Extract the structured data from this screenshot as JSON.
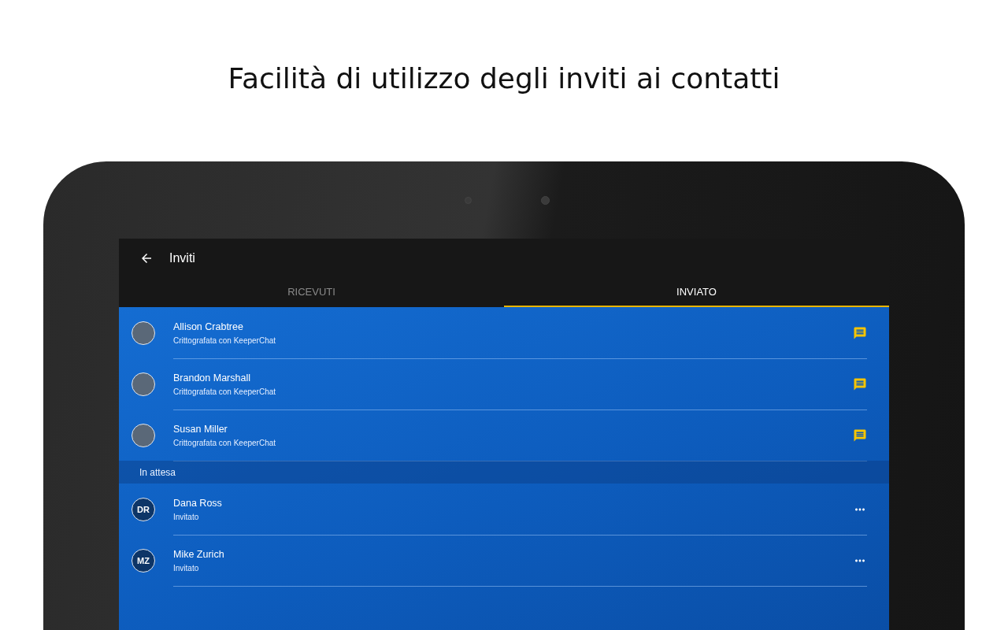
{
  "headline": "Facilità di utilizzo degli inviti ai contatti",
  "app_bar": {
    "title": "Inviti"
  },
  "tabs": [
    {
      "label": "RICEVUTI",
      "selected": false
    },
    {
      "label": "INVIATO",
      "selected": true
    }
  ],
  "groups": [
    {
      "items": [
        {
          "kind": "contact",
          "name": "Allison Crabtree",
          "subtitle": "Crittografata con KeeperChat"
        },
        {
          "kind": "contact",
          "name": "Brandon Marshall",
          "subtitle": "Crittografata con KeeperChat"
        },
        {
          "kind": "contact",
          "name": "Susan Miller",
          "subtitle": "Crittografata con KeeperChat"
        }
      ]
    },
    {
      "header": "In attesa",
      "items": [
        {
          "kind": "pending",
          "initials": "DR",
          "name": "Dana Ross",
          "subtitle": "Invitato"
        },
        {
          "kind": "pending",
          "initials": "MZ",
          "name": "Mike Zurich",
          "subtitle": "Invitato"
        }
      ]
    }
  ]
}
